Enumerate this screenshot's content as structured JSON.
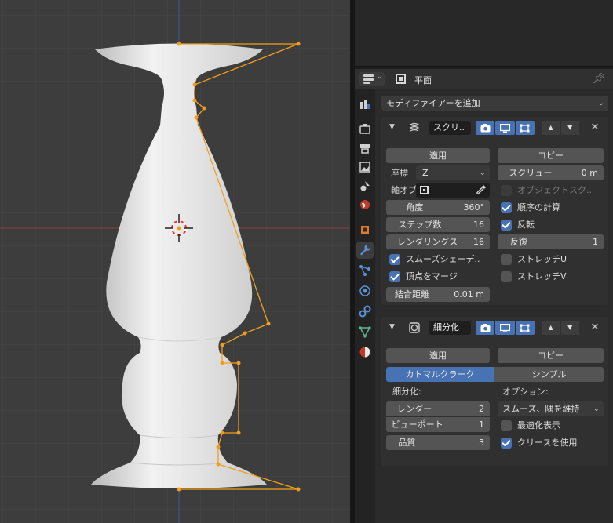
{
  "properties": {
    "object_name": "平面",
    "add_modifier": "モディファイアーを追加",
    "tabs": [
      "tool-icon",
      "render-icon",
      "output-icon",
      "view-layer-icon",
      "scene-icon",
      "world-icon",
      "object-icon",
      "modifier-icon",
      "particles-icon",
      "physics-icon",
      "constraints-icon",
      "data-icon",
      "material-icon"
    ],
    "active_tab": "modifier-icon"
  },
  "screw": {
    "name": "スクリ..",
    "apply": "適用",
    "copy": "コピー",
    "axis_label": "座標",
    "axis_value": "Z",
    "screw_label": "スクリュー",
    "screw_value": "0 m",
    "axis_object_label": "軸オブ",
    "object_screw": "オブジェクトスク..",
    "angle_label": "角度",
    "angle_value": "360°",
    "calc_order": "順序の計算",
    "steps_label": "ステップ数",
    "steps_value": "16",
    "flip": "反転",
    "render_steps_label": "レンダリングス",
    "render_steps_value": "16",
    "iterations_label": "反復",
    "iterations_value": "1",
    "smooth_shading": "スムーズシェーデ..",
    "stretch_u": "ストレッチU",
    "merge_vertices": "頂点をマージ",
    "stretch_v": "ストレッチV",
    "merge_distance_label": "結合距離",
    "merge_distance_value": "0.01 m"
  },
  "subsurf": {
    "name": "細分化",
    "apply": "適用",
    "copy": "コピー",
    "catmull_clark": "カトマルクラーク",
    "simple": "シンプル",
    "subdivision_label": "細分化:",
    "options_label": "オプション:",
    "render_label": "レンダー",
    "render_value": "2",
    "viewport_label": "ビューポート",
    "viewport_value": "1",
    "quality_label": "品質",
    "quality_value": "3",
    "uv_smooth": "スムーズ、隅を維持",
    "optimal_display": "最適化表示",
    "use_creases": "クリースを使用"
  },
  "colors": {
    "accent": "#4772b3",
    "selection": "#f29e1c",
    "x_axis": "#8d3a3a",
    "z_axis": "#3a5a8d"
  }
}
